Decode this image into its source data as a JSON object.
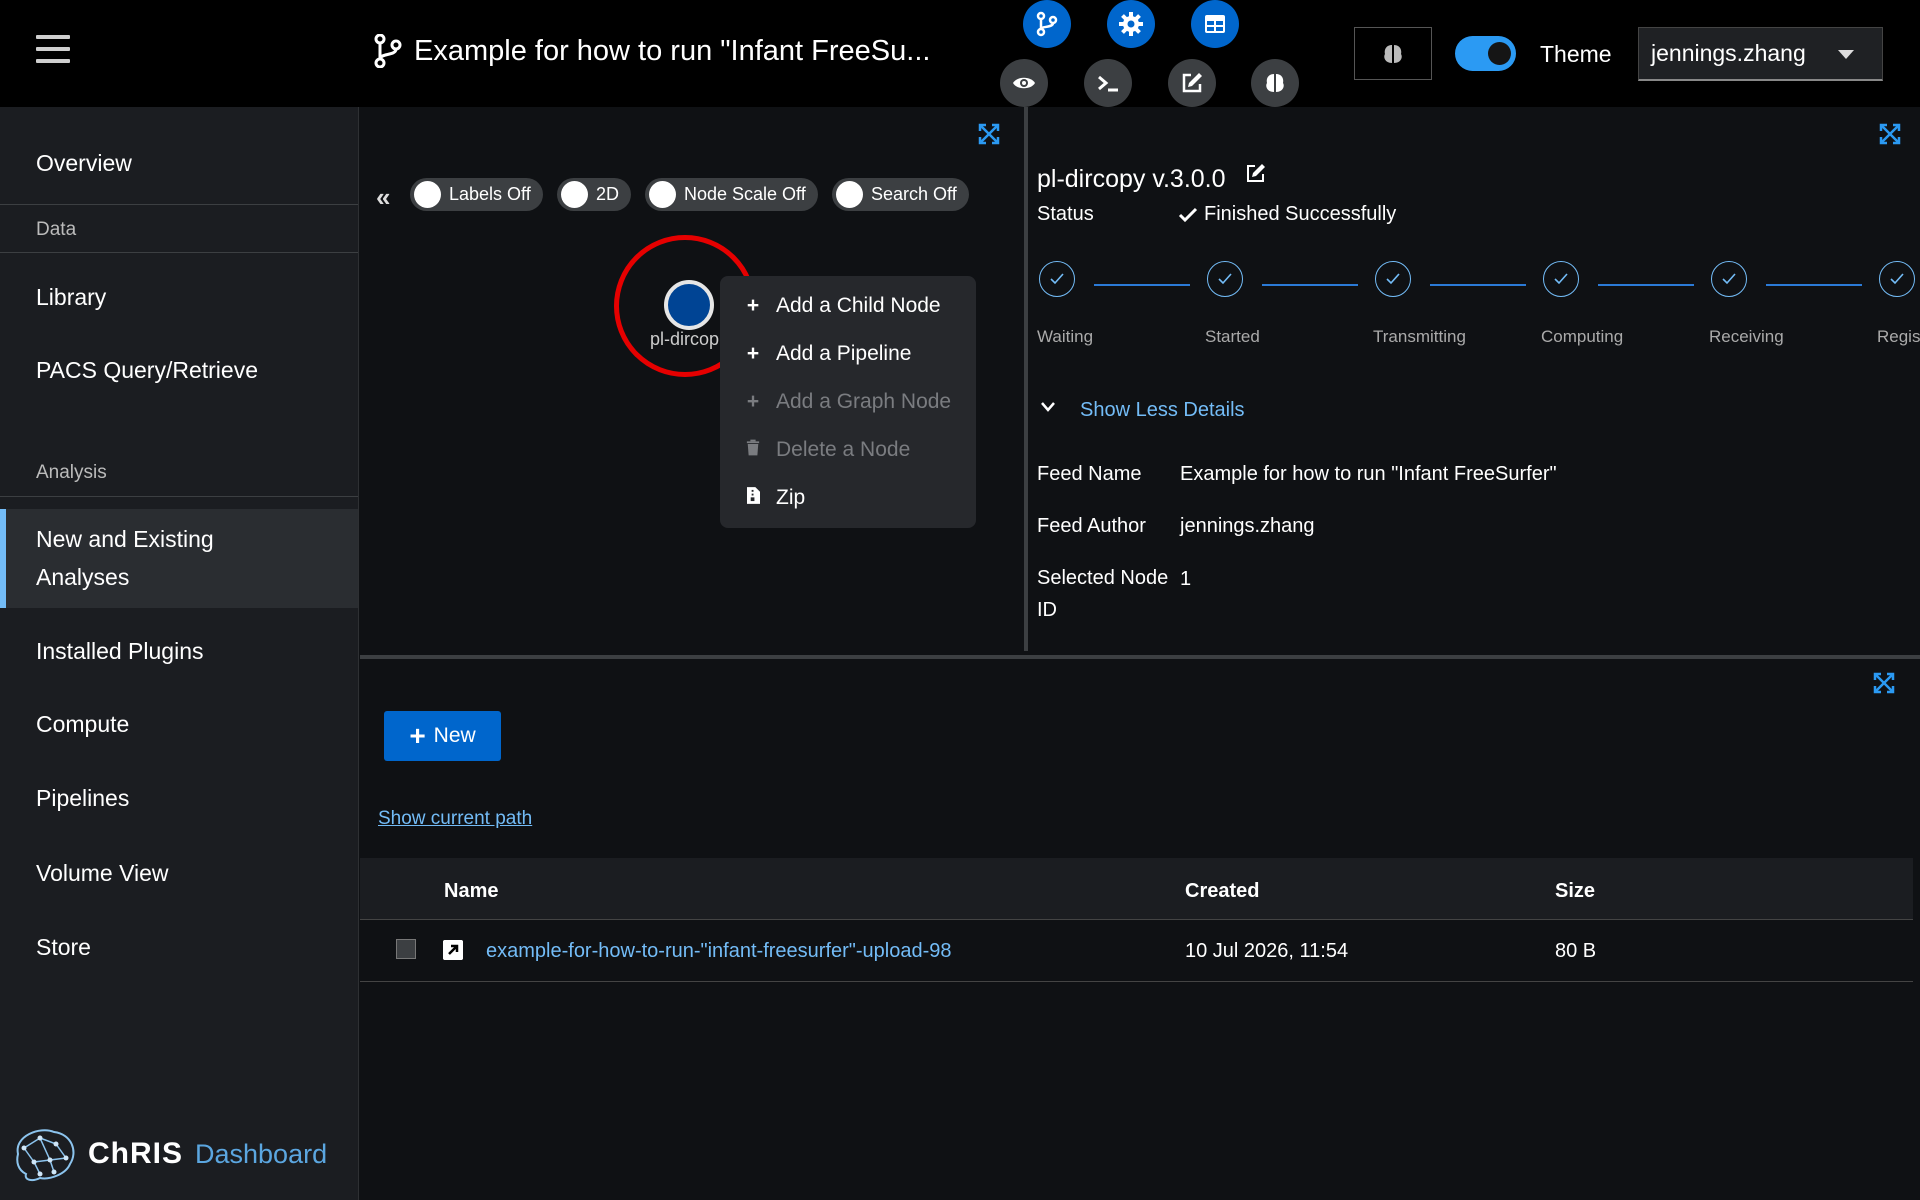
{
  "header": {
    "feed_title": "Example for how to run \"Infant FreeSu...",
    "theme_label": "Theme",
    "username": "jennings.zhang"
  },
  "sidebar": {
    "items": [
      {
        "label": "Overview"
      },
      {
        "label": "Library"
      },
      {
        "label": "PACS Query/Retrieve"
      },
      {
        "label": "New and Existing Analyses"
      },
      {
        "label": "Installed Plugins"
      },
      {
        "label": "Compute"
      },
      {
        "label": "Pipelines"
      },
      {
        "label": "Volume View"
      },
      {
        "label": "Store"
      }
    ],
    "sections": {
      "data": "Data",
      "analysis": "Analysis"
    },
    "brand": {
      "name": "ChRIS",
      "product": "Dashboard"
    }
  },
  "graph": {
    "toggles": {
      "labels": "Labels Off",
      "dim": "2D",
      "node_scale": "Node Scale Off",
      "search": "Search Off"
    },
    "node_label": "pl-dircop",
    "context_menu": [
      {
        "label": "Add a Child Node",
        "enabled": true
      },
      {
        "label": "Add a Pipeline",
        "enabled": true
      },
      {
        "label": "Add a Graph Node",
        "enabled": false
      },
      {
        "label": "Delete a Node",
        "enabled": false
      },
      {
        "label": "Zip",
        "enabled": true
      }
    ]
  },
  "details": {
    "plugin_title": "pl-dircopy v.3.0.0",
    "status_label": "Status",
    "status_value": "Finished Successfully",
    "steps": [
      "Waiting",
      "Started",
      "Transmitting",
      "Computing",
      "Receiving",
      "Regis"
    ],
    "show_less": "Show Less Details",
    "fields": {
      "feed_name_label": "Feed Name",
      "feed_name": "Example for how to run \"Infant FreeSurfer\"",
      "feed_author_label": "Feed Author",
      "feed_author": "jennings.zhang",
      "selected_node_label_1": "Selected Node",
      "selected_node_label_2": "ID",
      "selected_node": "1"
    }
  },
  "files": {
    "new_button": "New",
    "show_path": "Show current path",
    "columns": {
      "name": "Name",
      "created": "Created",
      "size": "Size"
    },
    "rows": [
      {
        "name": "example-for-how-to-run-\"infant-freesurfer\"-upload-98",
        "created": "10 Jul 2026, 11:54",
        "size": "80 B"
      }
    ]
  },
  "colors": {
    "accent": "#0066cc",
    "link": "#73bcf7",
    "highlight_ring": "#e60000",
    "node_fill": "#004494"
  }
}
